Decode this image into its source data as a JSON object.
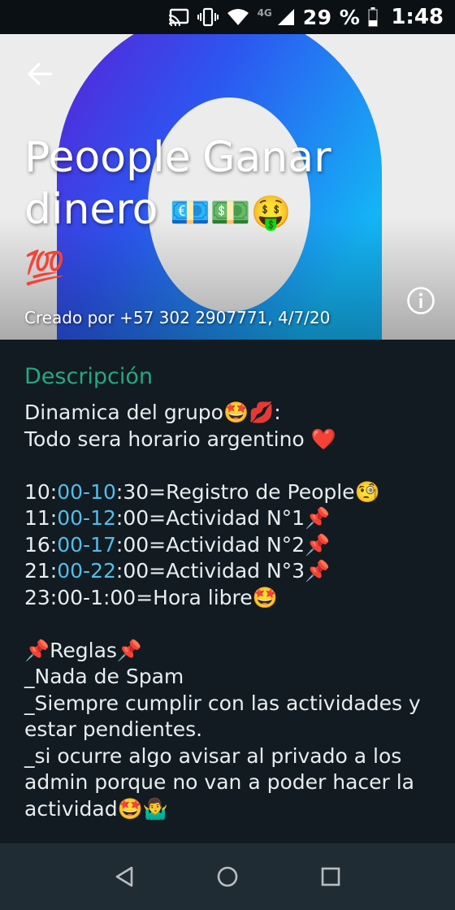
{
  "status_bar": {
    "network": "4G",
    "battery": "29 %",
    "time": "1:48",
    "icons": [
      "cast-icon",
      "vibrate-icon",
      "wifi-icon",
      "signal-icon",
      "battery-icon"
    ]
  },
  "header": {
    "back_icon": "arrow-left-icon",
    "title_line1": "Peoople Ganar",
    "title_line2": "dinero",
    "title_emojis": "💶💵🤑",
    "title_line3": "💯",
    "created_by": "Creado por +57 302 2907771, 4/7/20",
    "info_icon": "info-icon"
  },
  "description": {
    "heading": "Descripción",
    "lines": [
      "Dinamica del grupo🤩💋:",
      "Todo sera horario argentino ❤️",
      "",
      "10:00-10:30=Registro de People🧐",
      "11:00-12:00=Actividad N°1📌",
      "16:00-17:00=Actividad N°2📌",
      "21:00-22:00=Actividad N°3📌",
      "23:00-1:00=Hora libre🤩",
      "",
      "📌Reglas📌",
      "_Nada de Spam",
      "_Siempre cumplir con las actividades y",
      "estar pendientes.",
      "_si ocurre algo avisar al privado  a los",
      "admin porque no van a poder hacer la",
      "actividad🤩🤷‍♂️"
    ],
    "schedule": [
      {
        "start_h": "10:",
        "range": "00-10",
        "end_m": ":30=Registro de People🧐"
      },
      {
        "start_h": "11:",
        "range": "00-12",
        "end_m": ":00=Actividad N°1📌"
      },
      {
        "start_h": "16:",
        "range": "00-17",
        "end_m": ":00=Actividad N°2📌"
      },
      {
        "start_h": "21:",
        "range": "00-22",
        "end_m": ":00=Actividad N°3📌"
      }
    ]
  },
  "nav": {
    "back": "nav-back-icon",
    "home": "nav-home-icon",
    "recents": "nav-recents-icon"
  },
  "colors": {
    "accent": "#25a884",
    "link": "#53bdeb",
    "background": "#111b21",
    "navbar": "#202c33"
  }
}
